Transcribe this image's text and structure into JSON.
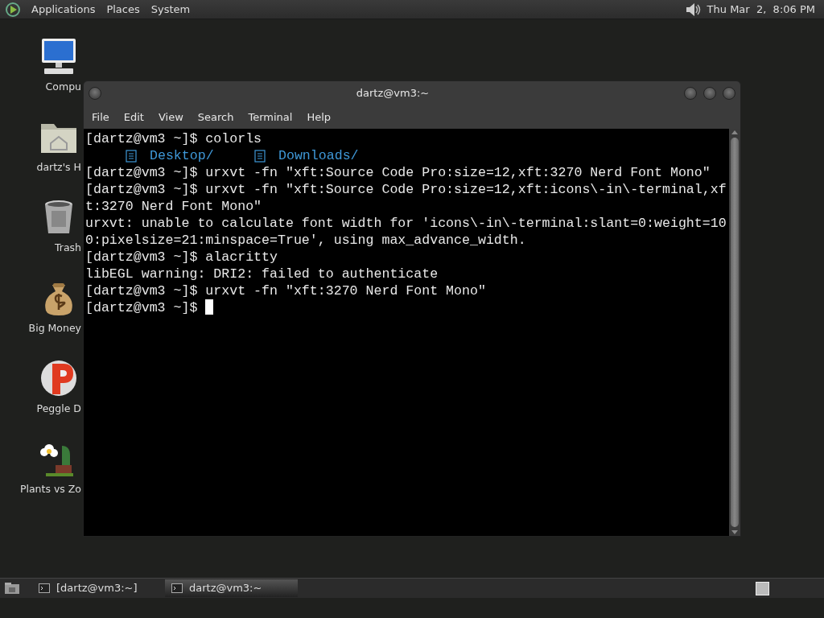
{
  "top_panel": {
    "menus": [
      "Applications",
      "Places",
      "System"
    ],
    "clock": "Thu Mar  2,  8:06 PM"
  },
  "desktop_icons": [
    {
      "kind": "computer",
      "label": "Compu"
    },
    {
      "kind": "home",
      "label": "dartz's H"
    },
    {
      "kind": "trash",
      "label": "Trash"
    },
    {
      "kind": "money",
      "label": "Big Money"
    },
    {
      "kind": "peggle",
      "label": "Peggle D"
    },
    {
      "kind": "plants",
      "label": "Plants vs Zo"
    }
  ],
  "window": {
    "title": "dartz@vm3:~",
    "menu": [
      "File",
      "Edit",
      "View",
      "Search",
      "Terminal",
      "Help"
    ],
    "lines": [
      {
        "kind": "text",
        "text": "[dartz@vm3 ~]$ colorls"
      },
      {
        "kind": "dirs",
        "entries": [
          "Desktop/",
          "Downloads/"
        ]
      },
      {
        "kind": "text",
        "text": "[dartz@vm3 ~]$ urxvt -fn \"xft:Source Code Pro:size=12,xft:3270 Nerd Font Mono\""
      },
      {
        "kind": "text",
        "text": "[dartz@vm3 ~]$ urxvt -fn \"xft:Source Code Pro:size=12,xft:icons\\-in\\-terminal,xf"
      },
      {
        "kind": "text",
        "text": "t:3270 Nerd Font Mono\""
      },
      {
        "kind": "text",
        "text": "urxvt: unable to calculate font width for 'icons\\-in\\-terminal:slant=0:weight=10"
      },
      {
        "kind": "text",
        "text": "0:pixelsize=21:minspace=True', using max_advance_width."
      },
      {
        "kind": "text",
        "text": "[dartz@vm3 ~]$ alacritty"
      },
      {
        "kind": "text",
        "text": "libEGL warning: DRI2: failed to authenticate"
      },
      {
        "kind": "text",
        "text": "[dartz@vm3 ~]$ urxvt -fn \"xft:3270 Nerd Font Mono\""
      },
      {
        "kind": "cursor",
        "text": "[dartz@vm3 ~]$"
      }
    ]
  },
  "taskbar": {
    "tasks": [
      {
        "label": "[dartz@vm3:~]",
        "selected": false
      },
      {
        "label": "dartz@vm3:~",
        "selected": true
      }
    ]
  }
}
